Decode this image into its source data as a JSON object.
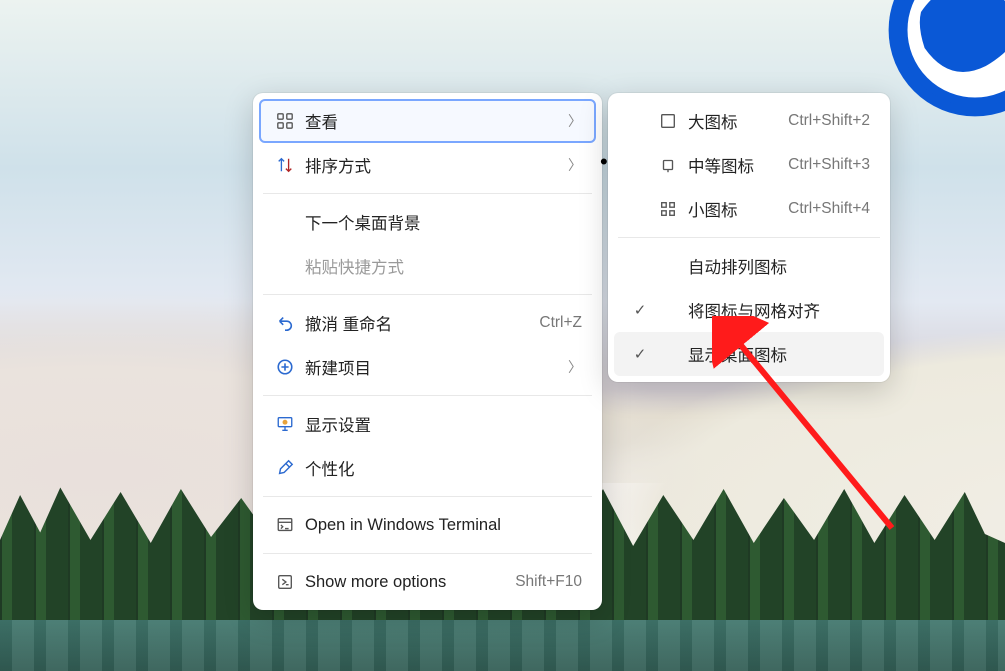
{
  "desktop": {
    "globe_icon_name": "browser-globe-icon"
  },
  "context_menu": {
    "items": [
      {
        "id": "view",
        "label": "查看",
        "has_submenu": true,
        "icon": "grid",
        "selected": true
      },
      {
        "id": "sort",
        "label": "排序方式",
        "has_submenu": true,
        "icon": "sort"
      },
      {
        "id": "nextbg",
        "label": "下一个桌面背景",
        "icon": ""
      },
      {
        "id": "paste",
        "label": "粘贴快捷方式",
        "icon": "",
        "disabled": true
      },
      {
        "id": "undo",
        "label": "撤消 重命名",
        "icon": "undo",
        "shortcut": "Ctrl+Z"
      },
      {
        "id": "new",
        "label": "新建项目",
        "icon": "plus",
        "has_submenu": true
      },
      {
        "id": "display",
        "label": "显示设置",
        "icon": "display"
      },
      {
        "id": "persona",
        "label": "个性化",
        "icon": "brush"
      },
      {
        "id": "terminal",
        "label": "Open in Windows Terminal",
        "icon": "terminal"
      },
      {
        "id": "more",
        "label": "Show more options",
        "icon": "more",
        "shortcut": "Shift+F10"
      }
    ],
    "separators_after": [
      "sort",
      "paste",
      "new",
      "persona",
      "terminal"
    ]
  },
  "view_submenu": {
    "items": [
      {
        "id": "large",
        "label": "大图标",
        "shortcut": "Ctrl+Shift+2",
        "icon": "rect-lg"
      },
      {
        "id": "medium",
        "label": "中等图标",
        "shortcut": "Ctrl+Shift+3",
        "icon": "rect-md",
        "current": true
      },
      {
        "id": "small",
        "label": "小图标",
        "shortcut": "Ctrl+Shift+4",
        "icon": "rect-sm"
      },
      {
        "id": "autoarr",
        "label": "自动排列图标"
      },
      {
        "id": "snap",
        "label": "将图标与网格对齐",
        "checked": true
      },
      {
        "id": "showdt",
        "label": "显示桌面图标",
        "checked": true,
        "highlighted": true
      }
    ],
    "separators_after": [
      "small"
    ]
  },
  "annotation": {
    "arrow_color": "#ff1b1b"
  }
}
